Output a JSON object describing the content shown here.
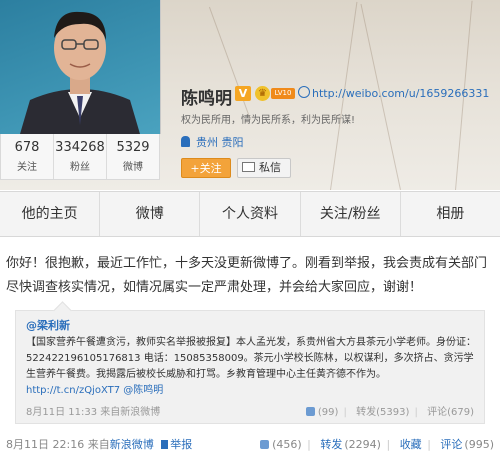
{
  "profile": {
    "name": "陈鸣明",
    "v_badge": "V",
    "level_badge": "LV10",
    "url": "http://weibo.com/u/1659266331",
    "bio": "权为民所用，情为民所系，利为民所谋!",
    "location": "贵州 贵阳",
    "follow_label": "+关注",
    "message_label": "私信"
  },
  "stats": [
    {
      "num": "678",
      "label": "关注"
    },
    {
      "num": "334268",
      "label": "粉丝"
    },
    {
      "num": "5329",
      "label": "微博"
    }
  ],
  "tabs": [
    "他的主页",
    "微博",
    "个人资料",
    "关注/粉丝",
    "相册"
  ],
  "post": {
    "text": "你好！很抱歉，最近工作忙，十多天没更新微博了。刚看到举报，我会责成有关部门尽快调查核实情况，如情况属实一定严肃处理，并会给大家回应，谢谢！",
    "time": "8月11日 22:16",
    "source_prefix": "来自",
    "source": "新浪微博",
    "report": "举报",
    "likes": "(456)",
    "repost_label": "转发",
    "repost_count": "(2294)",
    "fav_label": "收藏",
    "comment_label": "评论",
    "comment_count": "(995)"
  },
  "quote": {
    "author": "@梁利新",
    "text": "【国家营养午餐遭贪污，教师实名举报被报复】本人孟光发，系贵州省大方县茶元小学老师。身份证：522422196105176813 电话：15085358009。茶元小学校长陈林，以权谋利，多次挤占、贪污学生营养午餐费。我揭露后被校长威胁和打骂。乡教育管理中心主任黄齐德不作为。",
    "link": "http://t.cn/zQjoXT7",
    "mention": "@陈鸣明",
    "time": "8月11日 11:33",
    "source_prefix": "来自",
    "source": "新浪微博",
    "likes": "(99)",
    "repost": "转发(5393)",
    "comment": "评论(679)"
  }
}
